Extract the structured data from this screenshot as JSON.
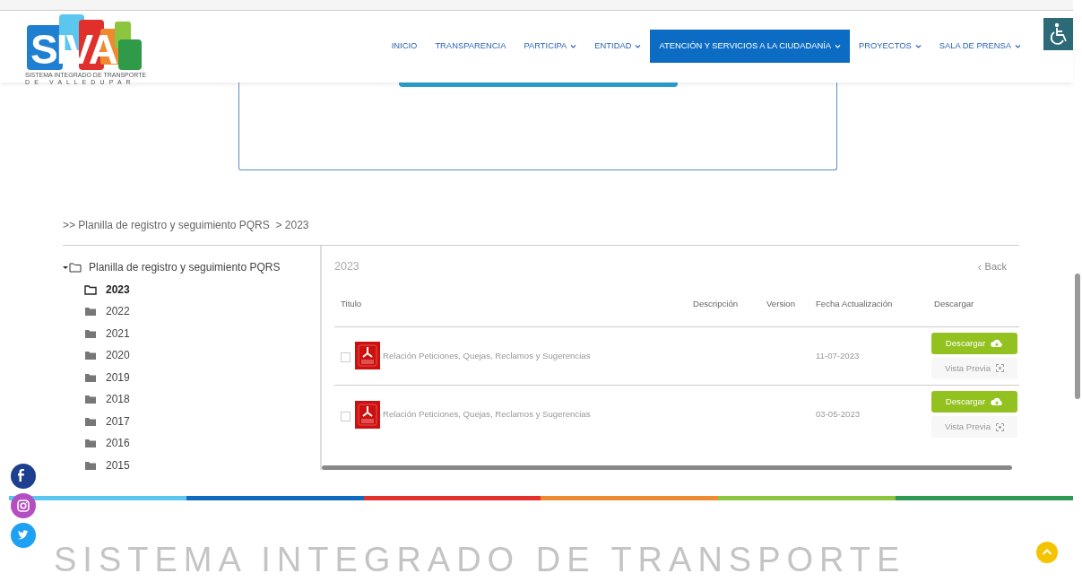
{
  "logo": {
    "mark": "SIVA",
    "line_1": "SISTEMA INTEGRADO DE TRANSPORTE",
    "line_2": "D E   V A L L E D U P A R"
  },
  "nav": [
    {
      "label": "INICIO",
      "dropdown": false,
      "selected": false
    },
    {
      "label": "TRANSPARENCIA",
      "dropdown": false,
      "selected": false
    },
    {
      "label": "PARTICIPA",
      "dropdown": true,
      "selected": false
    },
    {
      "label": "ENTIDAD",
      "dropdown": true,
      "selected": false
    },
    {
      "label": "ATENCIÓN Y SERVICIOS A LA CIUDADANÍA",
      "dropdown": true,
      "selected": true
    },
    {
      "label": "PROYECTOS",
      "dropdown": true,
      "selected": false
    },
    {
      "label": "SALA DE PRENSA",
      "dropdown": true,
      "selected": false
    }
  ],
  "breadcrumb": ">> Planilla de registro y seguimiento PQRS  > 2023",
  "tree": {
    "label": "Planilla de registro y seguimiento PQRS",
    "expanded": true,
    "children": [
      {
        "label": "2023",
        "selected": true
      },
      {
        "label": "2022",
        "selected": false
      },
      {
        "label": "2021",
        "selected": false
      },
      {
        "label": "2020",
        "selected": false
      },
      {
        "label": "2019",
        "selected": false
      },
      {
        "label": "2018",
        "selected": false
      },
      {
        "label": "2017",
        "selected": false
      },
      {
        "label": "2016",
        "selected": false
      },
      {
        "label": "2015",
        "selected": false
      }
    ]
  },
  "panel": {
    "title": "2023",
    "back": "Back",
    "columns": [
      "Titulo",
      "Descripción",
      "Version",
      "Fecha Actualización",
      "Descargar"
    ],
    "rows": [
      {
        "checked": false,
        "title": "Relación Peticiones, Quejas, Reclamos y Sugerencias",
        "date": "11-07-2023",
        "download": "Descargar",
        "preview": "Vista Previa"
      },
      {
        "checked": false,
        "title": "Relación Peticiones, Quejas, Reclamos y Sugerencias",
        "date": "03-05-2023",
        "download": "Descargar",
        "preview": "Vista Previa"
      }
    ]
  },
  "footer_title": "SISTEMA INTEGRADO DE TRANSPORTE"
}
